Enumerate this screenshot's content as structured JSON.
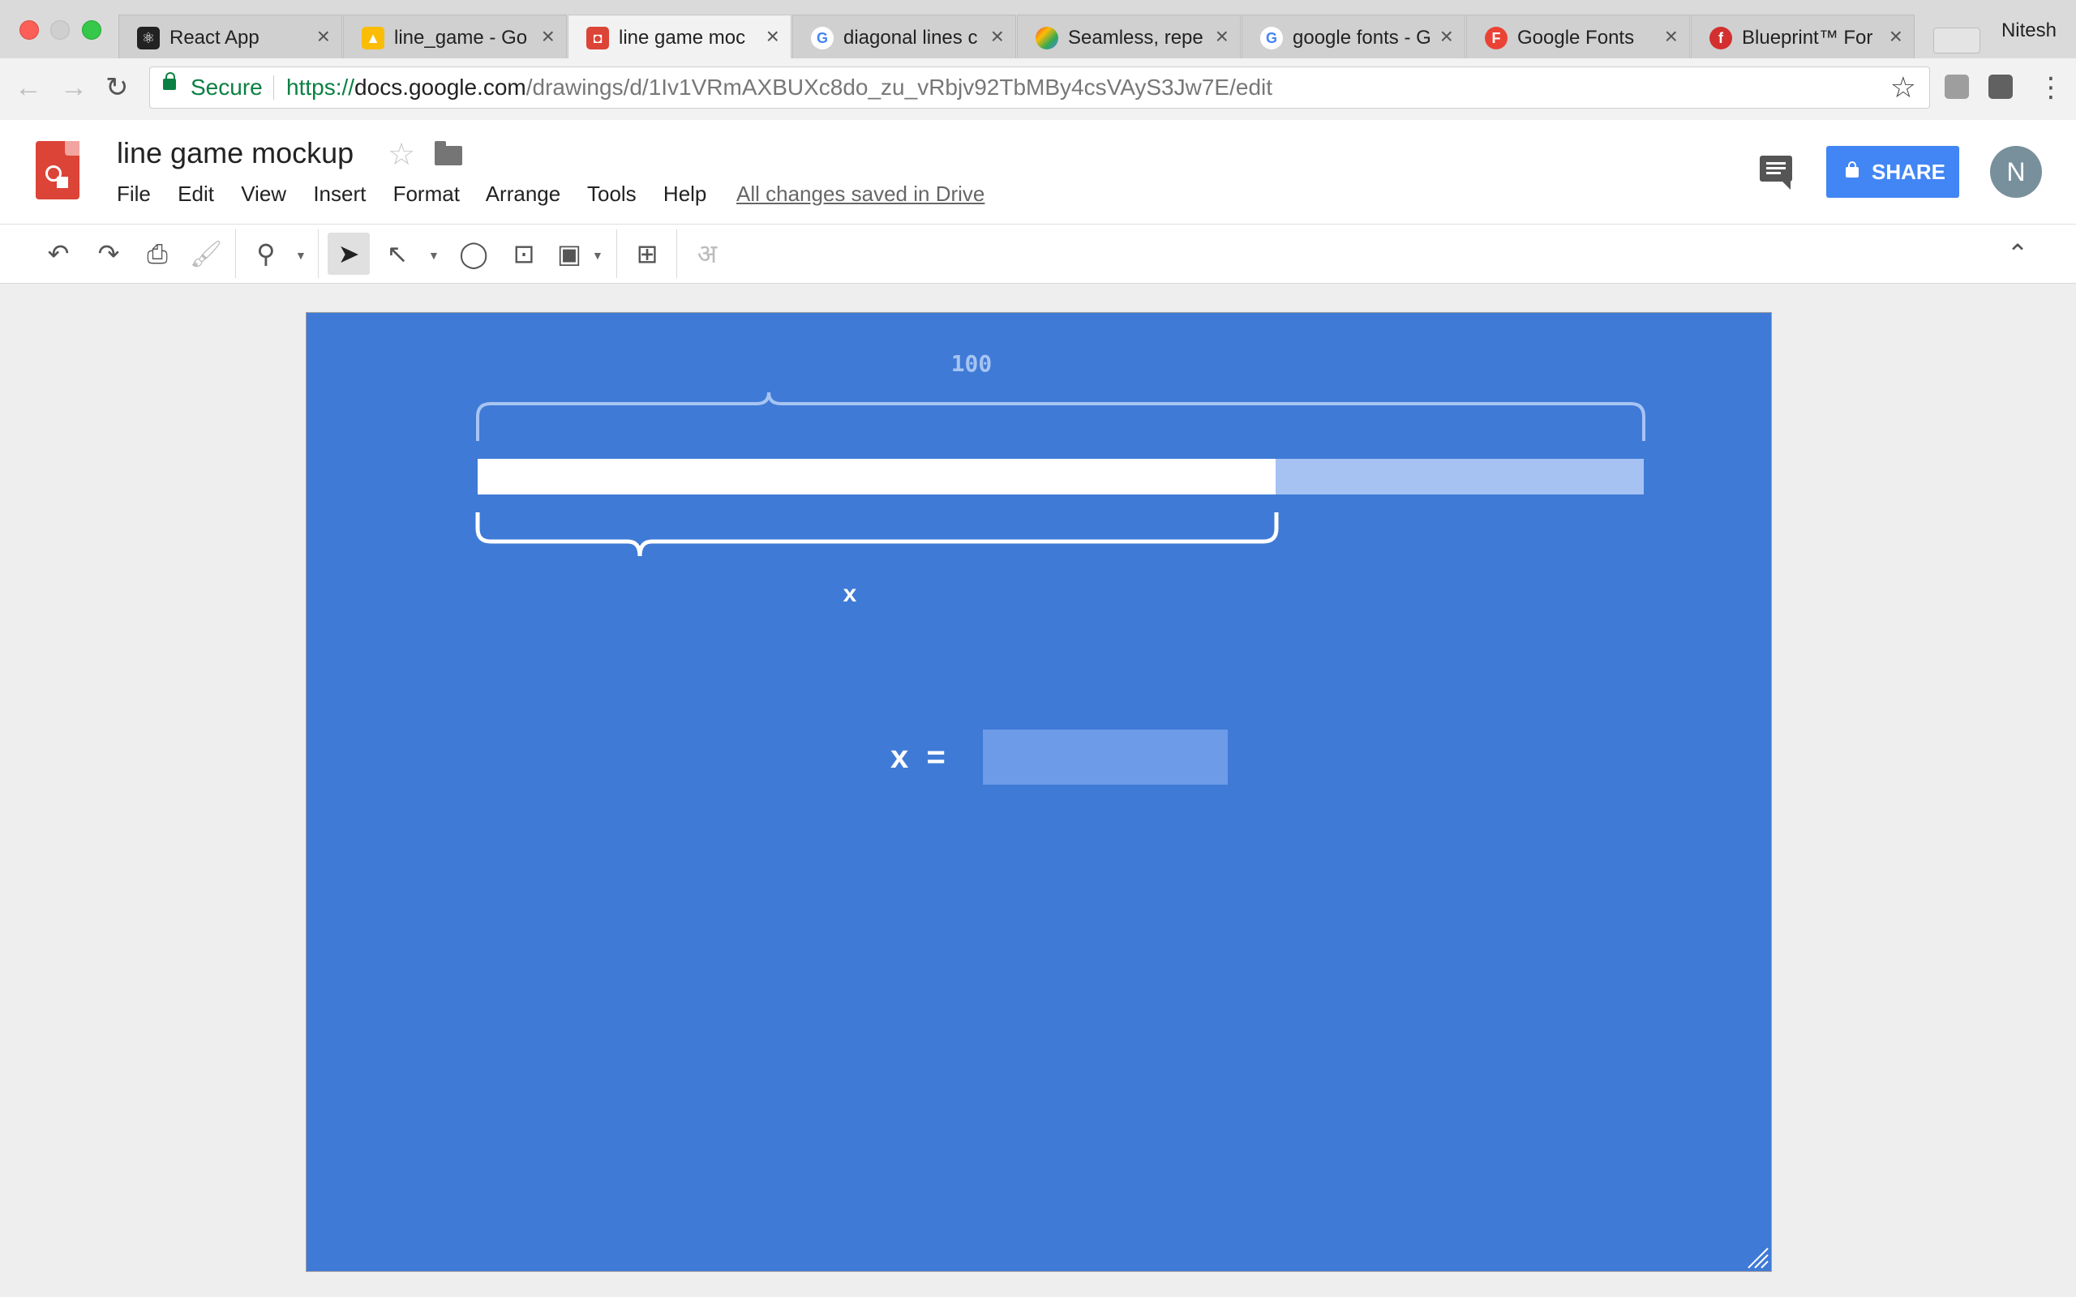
{
  "browser": {
    "tabs": [
      {
        "title": "React App",
        "favicon": "react-icon",
        "color": "#222222",
        "active": false
      },
      {
        "title": "line_game - Go",
        "favicon": "google-drive-icon",
        "color": "#fbbc05",
        "active": false
      },
      {
        "title": "line game moc",
        "favicon": "google-drawings-icon",
        "color": "#db4437",
        "active": true
      },
      {
        "title": "diagonal lines c",
        "favicon": "google-icon",
        "color": "#4285f4",
        "active": false
      },
      {
        "title": "Seamless, repe",
        "favicon": "colorful-icon",
        "color": "#34a853",
        "active": false
      },
      {
        "title": "google fonts - G",
        "favicon": "google-icon",
        "color": "#4285f4",
        "active": false
      },
      {
        "title": "Google Fonts",
        "favicon": "google-fonts-icon",
        "color": "#ea4335",
        "active": false
      },
      {
        "title": "Blueprint™ For",
        "favicon": "fontshop-icon",
        "color": "#d32f2f",
        "active": false
      }
    ],
    "user": "Nitesh",
    "secure_label": "Secure",
    "url_protocol": "https://",
    "url_host": "docs.google.com",
    "url_path": "/drawings/d/1Iv1VRmAXBUXc8do_zu_vRbjv92TbMBy4csVAyS3Jw7E/edit"
  },
  "app": {
    "title": "line game mockup",
    "menu": [
      "File",
      "Edit",
      "View",
      "Insert",
      "Format",
      "Arrange",
      "Tools",
      "Help"
    ],
    "save_status": "All changes saved in Drive",
    "share_label": "SHARE",
    "avatar_initial": "N",
    "accent": "#4285f4",
    "toolbar": [
      "undo-icon",
      "redo-icon",
      "print-icon",
      "paint-format-icon",
      "zoom-icon",
      "select-icon",
      "line-icon",
      "shape-icon",
      "text-box-icon",
      "image-icon",
      "comment-icon",
      "input-tools-icon"
    ],
    "input_tools_glyph": "अ"
  },
  "canvas": {
    "background": "#3f7ad6",
    "total_label": "100",
    "bar_fraction": 0.684,
    "x_label": "x",
    "equation_label": "x  =",
    "input_value": ""
  }
}
